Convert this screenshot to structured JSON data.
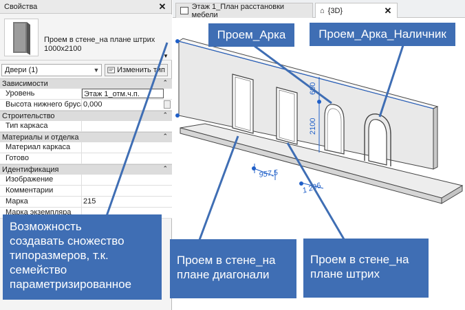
{
  "properties": {
    "title": "Свойства",
    "type_name_line1": "Проем в стене_на плане штрих",
    "type_name_line2": "1000x2100",
    "instance_filter": "Двери (1)",
    "edit_type_label": "Изменить тип",
    "sections": [
      {
        "title": "Зависимости",
        "rows": [
          {
            "key": "Уровень",
            "value": "Этаж 1_отм.ч.п."
          },
          {
            "key": "Высота нижнего бруса",
            "value": "0,000"
          }
        ]
      },
      {
        "title": "Строительство",
        "rows": [
          {
            "key": "Тип каркаса",
            "value": ""
          }
        ]
      },
      {
        "title": "Материалы и отделка",
        "rows": [
          {
            "key": "Материал каркаса",
            "value": ""
          },
          {
            "key": "Готово",
            "value": ""
          }
        ]
      },
      {
        "title": "Идентификация",
        "rows": [
          {
            "key": "Изображение",
            "value": ""
          },
          {
            "key": "Комментарии",
            "value": ""
          },
          {
            "key": "Марка",
            "value": "215"
          },
          {
            "key": "Марка экземпляра",
            "value": ""
          }
        ]
      }
    ]
  },
  "tabs": [
    {
      "label": "Этаж 1_План расстановки мебели"
    },
    {
      "label": "{3D}"
    }
  ],
  "dimensions": {
    "d600": "600",
    "d2100": "2100",
    "d957": "957,5",
    "d1296": "1 296"
  },
  "callouts": {
    "arka": "Проем_Арка",
    "arka_nalichnik": "Проем_Арка_Наличник",
    "feature_l1": "Возможность",
    "feature_l2": "создавать сножество",
    "feature_l3": "типоразмеров, т.к.",
    "feature_l4": "семейство",
    "feature_l5": "параметризированное",
    "diag_l1": "Проем в стене_на",
    "diag_l2": "плане диагонали",
    "shtrih_l1": "Проем в стене_на",
    "shtrih_l2": "плане штрих"
  },
  "colors": {
    "callout_bg": "#3f6eb4",
    "dim_blue": "#1f5fc8"
  }
}
